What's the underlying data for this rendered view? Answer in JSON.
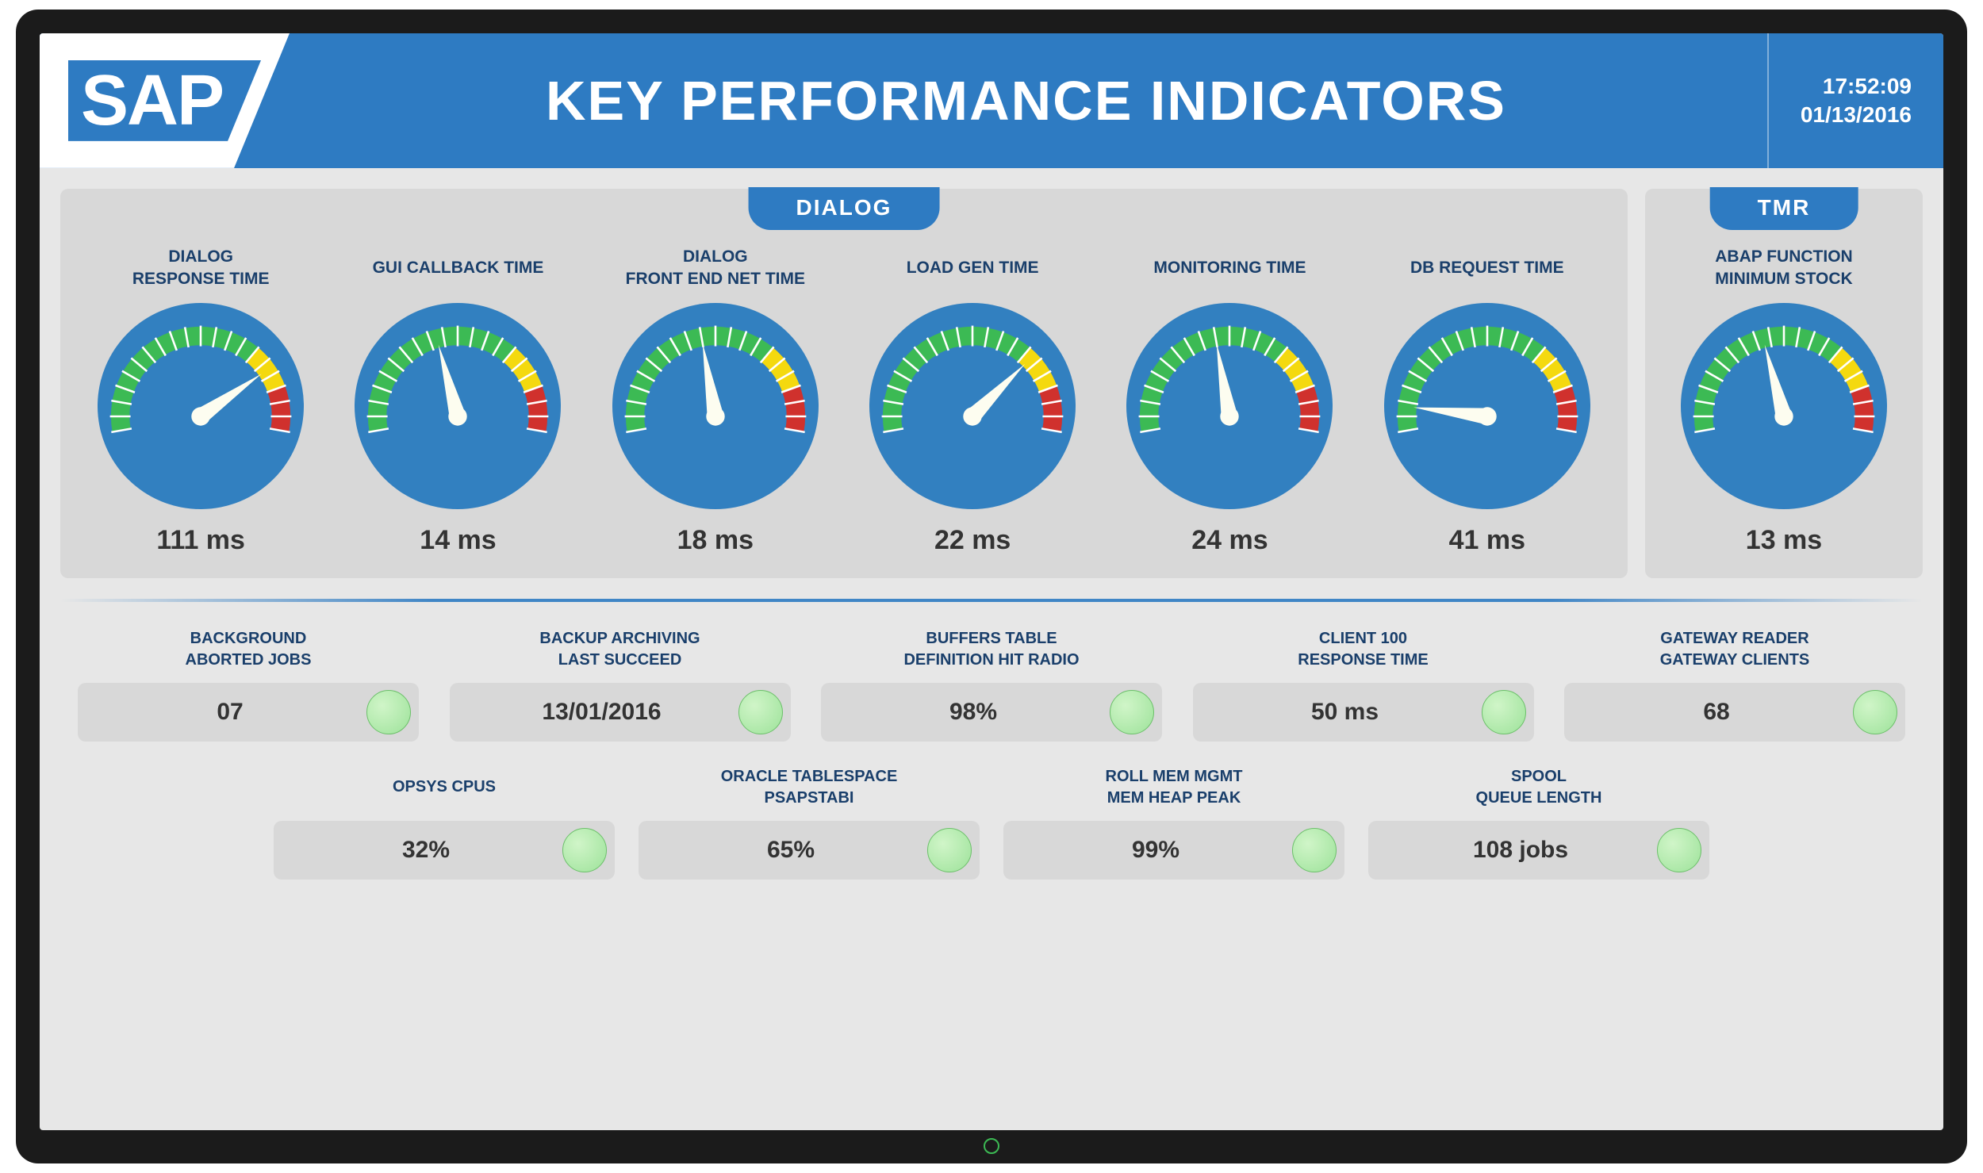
{
  "header": {
    "logo_text": "SAP",
    "title": "KEY PERFORMANCE INDICATORS",
    "time": "17:52:09",
    "date": "01/13/2016"
  },
  "panels": {
    "dialog": {
      "tab_label": "DIALOG",
      "gauges": [
        {
          "title1": "DIALOG",
          "title2": "RESPONSE TIME",
          "value": "111 ms",
          "needle_angle": 155
        },
        {
          "title1": "GUI CALLBACK TIME",
          "title2": "",
          "value": "14 ms",
          "needle_angle": 85
        },
        {
          "title1": "DIALOG",
          "title2": "FRONT END NET TIME",
          "value": "18 ms",
          "needle_angle": 90
        },
        {
          "title1": "LOAD GEN TIME",
          "title2": "",
          "value": "22 ms",
          "needle_angle": 145
        },
        {
          "title1": "MONITORING TIME",
          "title2": "",
          "value": "24 ms",
          "needle_angle": 90
        },
        {
          "title1": "DB REQUEST TIME",
          "title2": "",
          "value": "41 ms",
          "needle_angle": 17
        }
      ]
    },
    "tmr": {
      "tab_label": "TMR",
      "gauges": [
        {
          "title1": "ABAP FUNCTION",
          "title2": "MINIMUM STOCK",
          "value": "13 ms",
          "needle_angle": 85
        }
      ]
    }
  },
  "stats": {
    "row1": [
      {
        "title1": "BACKGROUND",
        "title2": "ABORTED JOBS",
        "value": "07"
      },
      {
        "title1": "BACKUP ARCHIVING",
        "title2": "LAST SUCCEED",
        "value": "13/01/2016"
      },
      {
        "title1": "BUFFERS TABLE",
        "title2": "DEFINITION HIT RADIO",
        "value": "98%"
      },
      {
        "title1": "CLIENT 100",
        "title2": "RESPONSE TIME",
        "value": "50 ms"
      },
      {
        "title1": "GATEWAY READER",
        "title2": "GATEWAY CLIENTS",
        "value": "68"
      }
    ],
    "row2": [
      {
        "title1": "OPSYS CPUS",
        "title2": "",
        "value": "32%"
      },
      {
        "title1": "ORACLE TABLESPACE",
        "title2": "PSAPSTABI",
        "value": "65%"
      },
      {
        "title1": "ROLL MEM MGMT",
        "title2": "MEM HEAP PEAK",
        "value": "99%"
      },
      {
        "title1": "SPOOL",
        "title2": "QUEUE LENGTH",
        "value": "108 jobs"
      }
    ]
  },
  "colors": {
    "brand": "#2e7bc2",
    "gauge_face": "#3280c0",
    "green": "#3cba54",
    "yellow": "#f4d90f",
    "red": "#d0312d",
    "panel_bg": "#d8d8d8",
    "screen_bg": "#e7e7e7",
    "text_dark": "#1a3f6b"
  },
  "chart_data": [
    {
      "type": "gauge",
      "label": "DIALOG RESPONSE TIME",
      "value": 111,
      "unit": "ms"
    },
    {
      "type": "gauge",
      "label": "GUI CALLBACK TIME",
      "value": 14,
      "unit": "ms"
    },
    {
      "type": "gauge",
      "label": "DIALOG FRONT END NET TIME",
      "value": 18,
      "unit": "ms"
    },
    {
      "type": "gauge",
      "label": "LOAD GEN TIME",
      "value": 22,
      "unit": "ms"
    },
    {
      "type": "gauge",
      "label": "MONITORING TIME",
      "value": 24,
      "unit": "ms"
    },
    {
      "type": "gauge",
      "label": "DB REQUEST TIME",
      "value": 41,
      "unit": "ms"
    },
    {
      "type": "gauge",
      "label": "ABAP FUNCTION MINIMUM STOCK",
      "value": 13,
      "unit": "ms"
    }
  ]
}
